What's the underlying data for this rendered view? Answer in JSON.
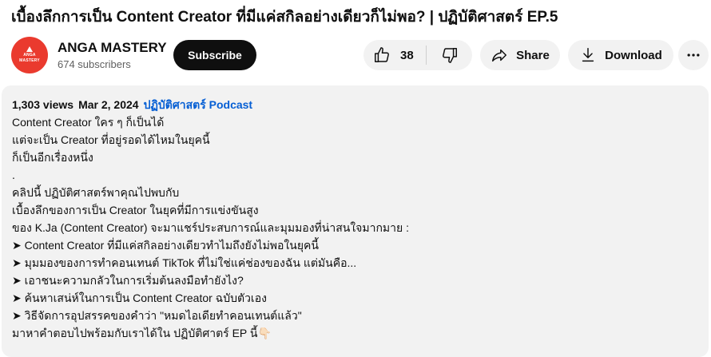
{
  "video": {
    "title": "เบื้องลึกการเป็น Content Creator ที่มีแค่สกิลอย่างเดียวก็ไม่พอ? | ปฏิบัติศาสตร์ EP.5"
  },
  "channel": {
    "name": "ANGA MASTERY",
    "subscribers": "674 subscribers",
    "avatar_text_line1": "ANGA",
    "avatar_text_line2": "MASTERY",
    "avatar_color": "#ea3a2e"
  },
  "actions": {
    "subscribe_label": "Subscribe",
    "like_count": "38",
    "like_icon": "thumb-up-icon",
    "dislike_icon": "thumb-down-icon",
    "share_label": "Share",
    "share_icon": "share-icon",
    "download_label": "Download",
    "download_icon": "download-icon",
    "more_icon": "more-horizontal-icon"
  },
  "description": {
    "views": "1,303 views",
    "date": "Mar 2, 2024",
    "podcast_link": "ปฏิบัติศาสตร์ Podcast",
    "lines": [
      "Content Creator ใคร ๆ ก็เป็นได้",
      "แต่จะเป็น Creator ที่อยู่รอดได้ไหมในยุคนี้",
      "ก็เป็นอีกเรื่องหนึ่ง",
      ".",
      "คลิปนี้ ปฏิบัติศาสตร์พาคุณไปพบกับ",
      "เบื้องลึกของการเป็น Creator ในยุคที่มีการแข่งขันสูง",
      "ของ K.Ja (Content Creator) จะมาแชร์ประสบการณ์และมุมมองที่น่าสนใจมากมาย :",
      "➤ Content Creator ที่มีแค่สกิลอย่างเดียวทำไมถึงยังไม่พอในยุคนี้",
      "➤ มุมมองของการทำคอนเทนต์ TikTok ที่ไม่ใช่แค่ช่องของฉัน แต่มันคือ...",
      "➤ เอาชนะความกลัวในการเริ่มต้นลงมือทำยังไง?",
      "➤ ค้นหาเสน่ห์ในการเป็น Content Creator ฉบับตัวเอง",
      "➤ วิธีจัดการอุปสรรคของคำว่า \"หมดไอเดียทำคอนเทนต์แล้ว\"",
      "มาหาคำตอบไปพร้อมกับเราได้ใน ปฏิบัติศาตร์ EP นี้👇🏻"
    ]
  }
}
